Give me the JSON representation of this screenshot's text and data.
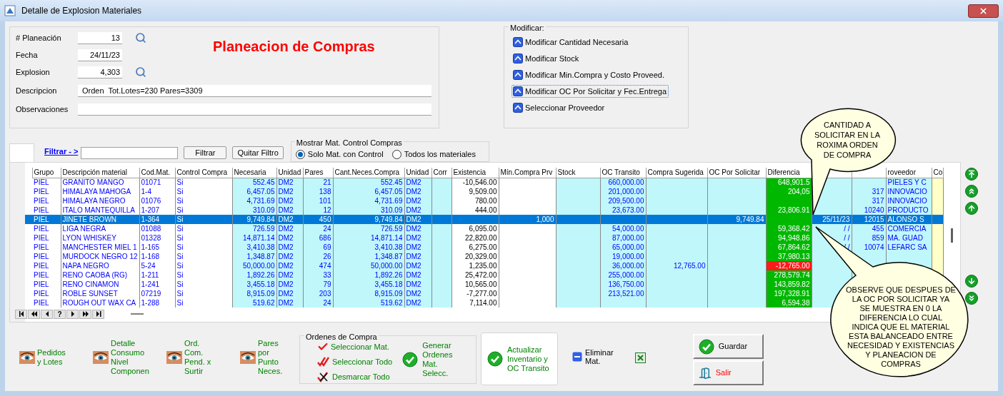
{
  "window": {
    "title": "Detalle de Explosion Materiales"
  },
  "header_form": {
    "title": "Planeacion de Compras",
    "fields": [
      {
        "label": "# Planeación",
        "value": "13",
        "kind": "lookup"
      },
      {
        "label": "Fecha",
        "value": "24/11/23",
        "kind": "short"
      },
      {
        "label": "Explosion",
        "value": "4,303",
        "kind": "lookup"
      },
      {
        "label": "Descripcion",
        "value": "Orden  Tot.Lotes=230 Pares=3309",
        "kind": "wide"
      },
      {
        "label": "Observaciones",
        "kind": "wide"
      }
    ]
  },
  "modificar": {
    "title": "Modificar:",
    "actions": [
      {
        "label": "Modificar Cantidad Necesaria",
        "focused": false
      },
      {
        "label": "Modificar Stock",
        "focused": false
      },
      {
        "label": "Modificar Min.Compra y Costo Proveed.",
        "focused": false
      },
      {
        "label": "Modificar OC Por Solicitar y Fec.Entrega",
        "focused": true
      },
      {
        "label": "Seleccionar Proveedor",
        "focused": false
      }
    ]
  },
  "filter": {
    "label": "Filtrar - >",
    "buttons": [
      "Filtrar",
      "Quitar Filtro"
    ]
  },
  "mostrar": {
    "title": "Mostrar Mat. Control Compras",
    "options": [
      {
        "label": "Solo Mat. con Control",
        "selected": true
      },
      {
        "label": "Todos los materiales",
        "selected": false
      }
    ]
  },
  "table": {
    "columns": [
      "Grupo",
      "Descripción material",
      "Cod.Mat.",
      "Control Compra",
      "Necesaria",
      "Unidad",
      "Pares",
      "Cant.Neces.Compra",
      "Unidad",
      "Corr",
      "Existencia",
      "Mín.Compra Prv",
      "Stock",
      "OC Transito",
      "Compra Sugerida",
      "OC Por Solicitar",
      "Diferencia",
      null,
      null,
      "roveedor",
      "Co"
    ],
    "rows": [
      {
        "selected": false,
        "alert": false,
        "cells": [
          "PIEL",
          "GRANITO MANGO",
          "01071",
          "Si",
          "552.45",
          "DM2",
          "21",
          "552.45",
          "DM2",
          null,
          "-10,546.00",
          null,
          null,
          "660,000.00",
          null,
          null,
          "648,901.5",
          null,
          null,
          "PIELES Y C",
          null
        ]
      },
      {
        "selected": false,
        "alert": false,
        "cells": [
          "PIEL",
          "HIMALAYA MAHOGA",
          "1-4",
          "Si",
          "6,457.05",
          "DM2",
          "138",
          "6,457.05",
          "DM2",
          null,
          "9,509.00",
          null,
          null,
          "201,000.00",
          null,
          null,
          "204,05",
          null,
          "317",
          "INNOVACIO",
          null
        ]
      },
      {
        "selected": false,
        "alert": false,
        "cells": [
          "PIEL",
          "HIMALAYA NEGRO",
          "01076",
          "Si",
          "4,731.69",
          "DM2",
          "101",
          "4,731.69",
          "DM2",
          null,
          "780.00",
          null,
          null,
          "209,500.00",
          null,
          null,
          null,
          null,
          "317",
          "INNOVACIO",
          null
        ]
      },
      {
        "selected": false,
        "alert": false,
        "cells": [
          "PIEL",
          "ITALO MANTEQUILLA",
          "1-207",
          "Si",
          "310.09",
          "DM2",
          "12",
          "310.09",
          "DM2",
          null,
          "444.00",
          null,
          null,
          "23,673.00",
          null,
          null,
          "23,806.91",
          null,
          "10240",
          "PRODUCTO",
          null
        ]
      },
      {
        "selected": true,
        "alert": false,
        "cells": [
          "PIEL",
          "JINETE BROWN",
          "1-364",
          "Si",
          "9,749.84",
          "DM2",
          "450",
          "9,749.84",
          "DM2",
          null,
          null,
          "1,000",
          null,
          null,
          null,
          "9,749.84",
          null,
          "25/11/23",
          "12015",
          "ALONSO S",
          null
        ]
      },
      {
        "selected": false,
        "alert": false,
        "cells": [
          "PIEL",
          "LIGA NEGRA",
          "01088",
          "Si",
          "726.59",
          "DM2",
          "24",
          "726.59",
          "DM2",
          null,
          "6,095.00",
          null,
          null,
          "54,000.00",
          null,
          null,
          "59,368.42",
          "/ /",
          "455",
          "COMERCIA",
          null
        ]
      },
      {
        "selected": false,
        "alert": false,
        "cells": [
          "PIEL",
          "LYON WHISKEY",
          "01328",
          "Si",
          "14,871.14",
          "DM2",
          "686",
          "14,871.14",
          "DM2",
          null,
          "22,820.00",
          null,
          null,
          "87,000.00",
          null,
          null,
          "94,948.86",
          "/ /",
          "859",
          "MA. GUAD",
          null
        ]
      },
      {
        "selected": false,
        "alert": false,
        "cells": [
          "PIEL",
          "MANCHESTER MIEL 1",
          "1-165",
          "Si",
          "3,410.38",
          "DM2",
          "69",
          "3,410.38",
          "DM2",
          null,
          "6,275.00",
          null,
          null,
          "65,000.00",
          null,
          null,
          "67,864.62",
          "/ /",
          "10074",
          "LEFARC SA",
          null
        ]
      },
      {
        "selected": false,
        "alert": false,
        "cells": [
          "PIEL",
          "MURDOCK NEGRO 12",
          "1-168",
          "Si",
          "1,348.87",
          "DM2",
          "26",
          "1,348.87",
          "DM2",
          null,
          "20,329.00",
          null,
          null,
          "19,000.00",
          null,
          null,
          "37,980.13",
          null,
          null,
          null,
          null
        ]
      },
      {
        "selected": false,
        "alert": true,
        "cells": [
          "PIEL",
          "NAPA NEGRO",
          "5-24",
          "Si",
          "50,000.00",
          "DM2",
          "474",
          "50,000.00",
          "DM2",
          null,
          "1,235.00",
          null,
          null,
          "36,000.00",
          "12,765.00",
          null,
          "-12,765.00",
          null,
          null,
          null,
          null
        ]
      },
      {
        "selected": false,
        "alert": false,
        "cells": [
          "PIEL",
          "RENO CAOBA (RG)",
          "1-211",
          "Si",
          "1,892.26",
          "DM2",
          "33",
          "1,892.26",
          "DM2",
          null,
          "25,472.00",
          null,
          null,
          "255,000.00",
          null,
          null,
          "278,579.74",
          null,
          null,
          null,
          null
        ]
      },
      {
        "selected": false,
        "alert": false,
        "cells": [
          "PIEL",
          "RENO CINAMON",
          "1-241",
          "Si",
          "3,455.18",
          "DM2",
          "79",
          "3,455.18",
          "DM2",
          null,
          "10,565.00",
          null,
          null,
          "136,750.00",
          null,
          null,
          "143,859.82",
          null,
          null,
          null,
          null
        ]
      },
      {
        "selected": false,
        "alert": false,
        "cells": [
          "PIEL",
          "ROBLE SUNSET",
          "07219",
          "Si",
          "8,915.09",
          "DM2",
          "203",
          "8,915.09",
          "DM2",
          null,
          "-7,277.00",
          null,
          null,
          "213,521.00",
          null,
          null,
          "197,328.91",
          null,
          null,
          null,
          null
        ]
      },
      {
        "selected": false,
        "alert": false,
        "cells": [
          "PIEL",
          "ROUGH OUT WAX CA",
          "1-288",
          "Si",
          "519.62",
          "DM2",
          "24",
          "519.62",
          "DM2",
          null,
          "7,114.00",
          null,
          null,
          null,
          null,
          null,
          "6,594.38",
          null,
          null,
          null,
          null
        ]
      }
    ]
  },
  "navigator": [
    {
      "kind": "first"
    },
    {
      "kind": "prev_page"
    },
    {
      "kind": "prev"
    },
    {
      "kind": "help",
      "label": "?"
    },
    {
      "kind": "next"
    },
    {
      "kind": "next_page"
    },
    {
      "kind": "last"
    }
  ],
  "bottom_links": [
    "Pedidos\ny Lotes",
    "Detalle\nConsumo\nNivel\nComponen",
    "Ord.\nCom.\nPend. x\nSurtir",
    "Pares\npor\nPunto\nNeces."
  ],
  "ordenes_compra": {
    "title": "Ordenes de Compra",
    "actions": [
      {
        "label": "Seleccionar Mat.",
        "kind": "check"
      },
      {
        "label": "Seleccionar Todo",
        "kind": "double_check"
      },
      {
        "label": "Desmarcar Todo",
        "kind": "uncheck"
      }
    ],
    "generate": "Generar\nOrdenes\nMat.\nSelecc."
  },
  "actualizar": "Actualizar\nInventario y\nOC Transito",
  "eliminar": "Eliminar\nMat.",
  "buttons": [
    {
      "label": "Guardar",
      "kind": "save"
    },
    {
      "label": "Salir",
      "kind": "exit"
    }
  ],
  "callouts": [
    "CANTIDAD A\nSOLICITAR EN LA\nROXIMA ORDEN\nDE COMPRA",
    "OBSERVE QUE DESPUES DE\nLA OC POR SOLICITAR YA\nSE MUESTRA EN 0 LA\nDIFERENCIA LO CUAL\nINDICA QUE EL MATERIAL\nESTA BALANCEADO ENTRE\nNECESIDAD Y EXISTENCIAS\nY PLANEACION DE\nCOMPRAS"
  ]
}
